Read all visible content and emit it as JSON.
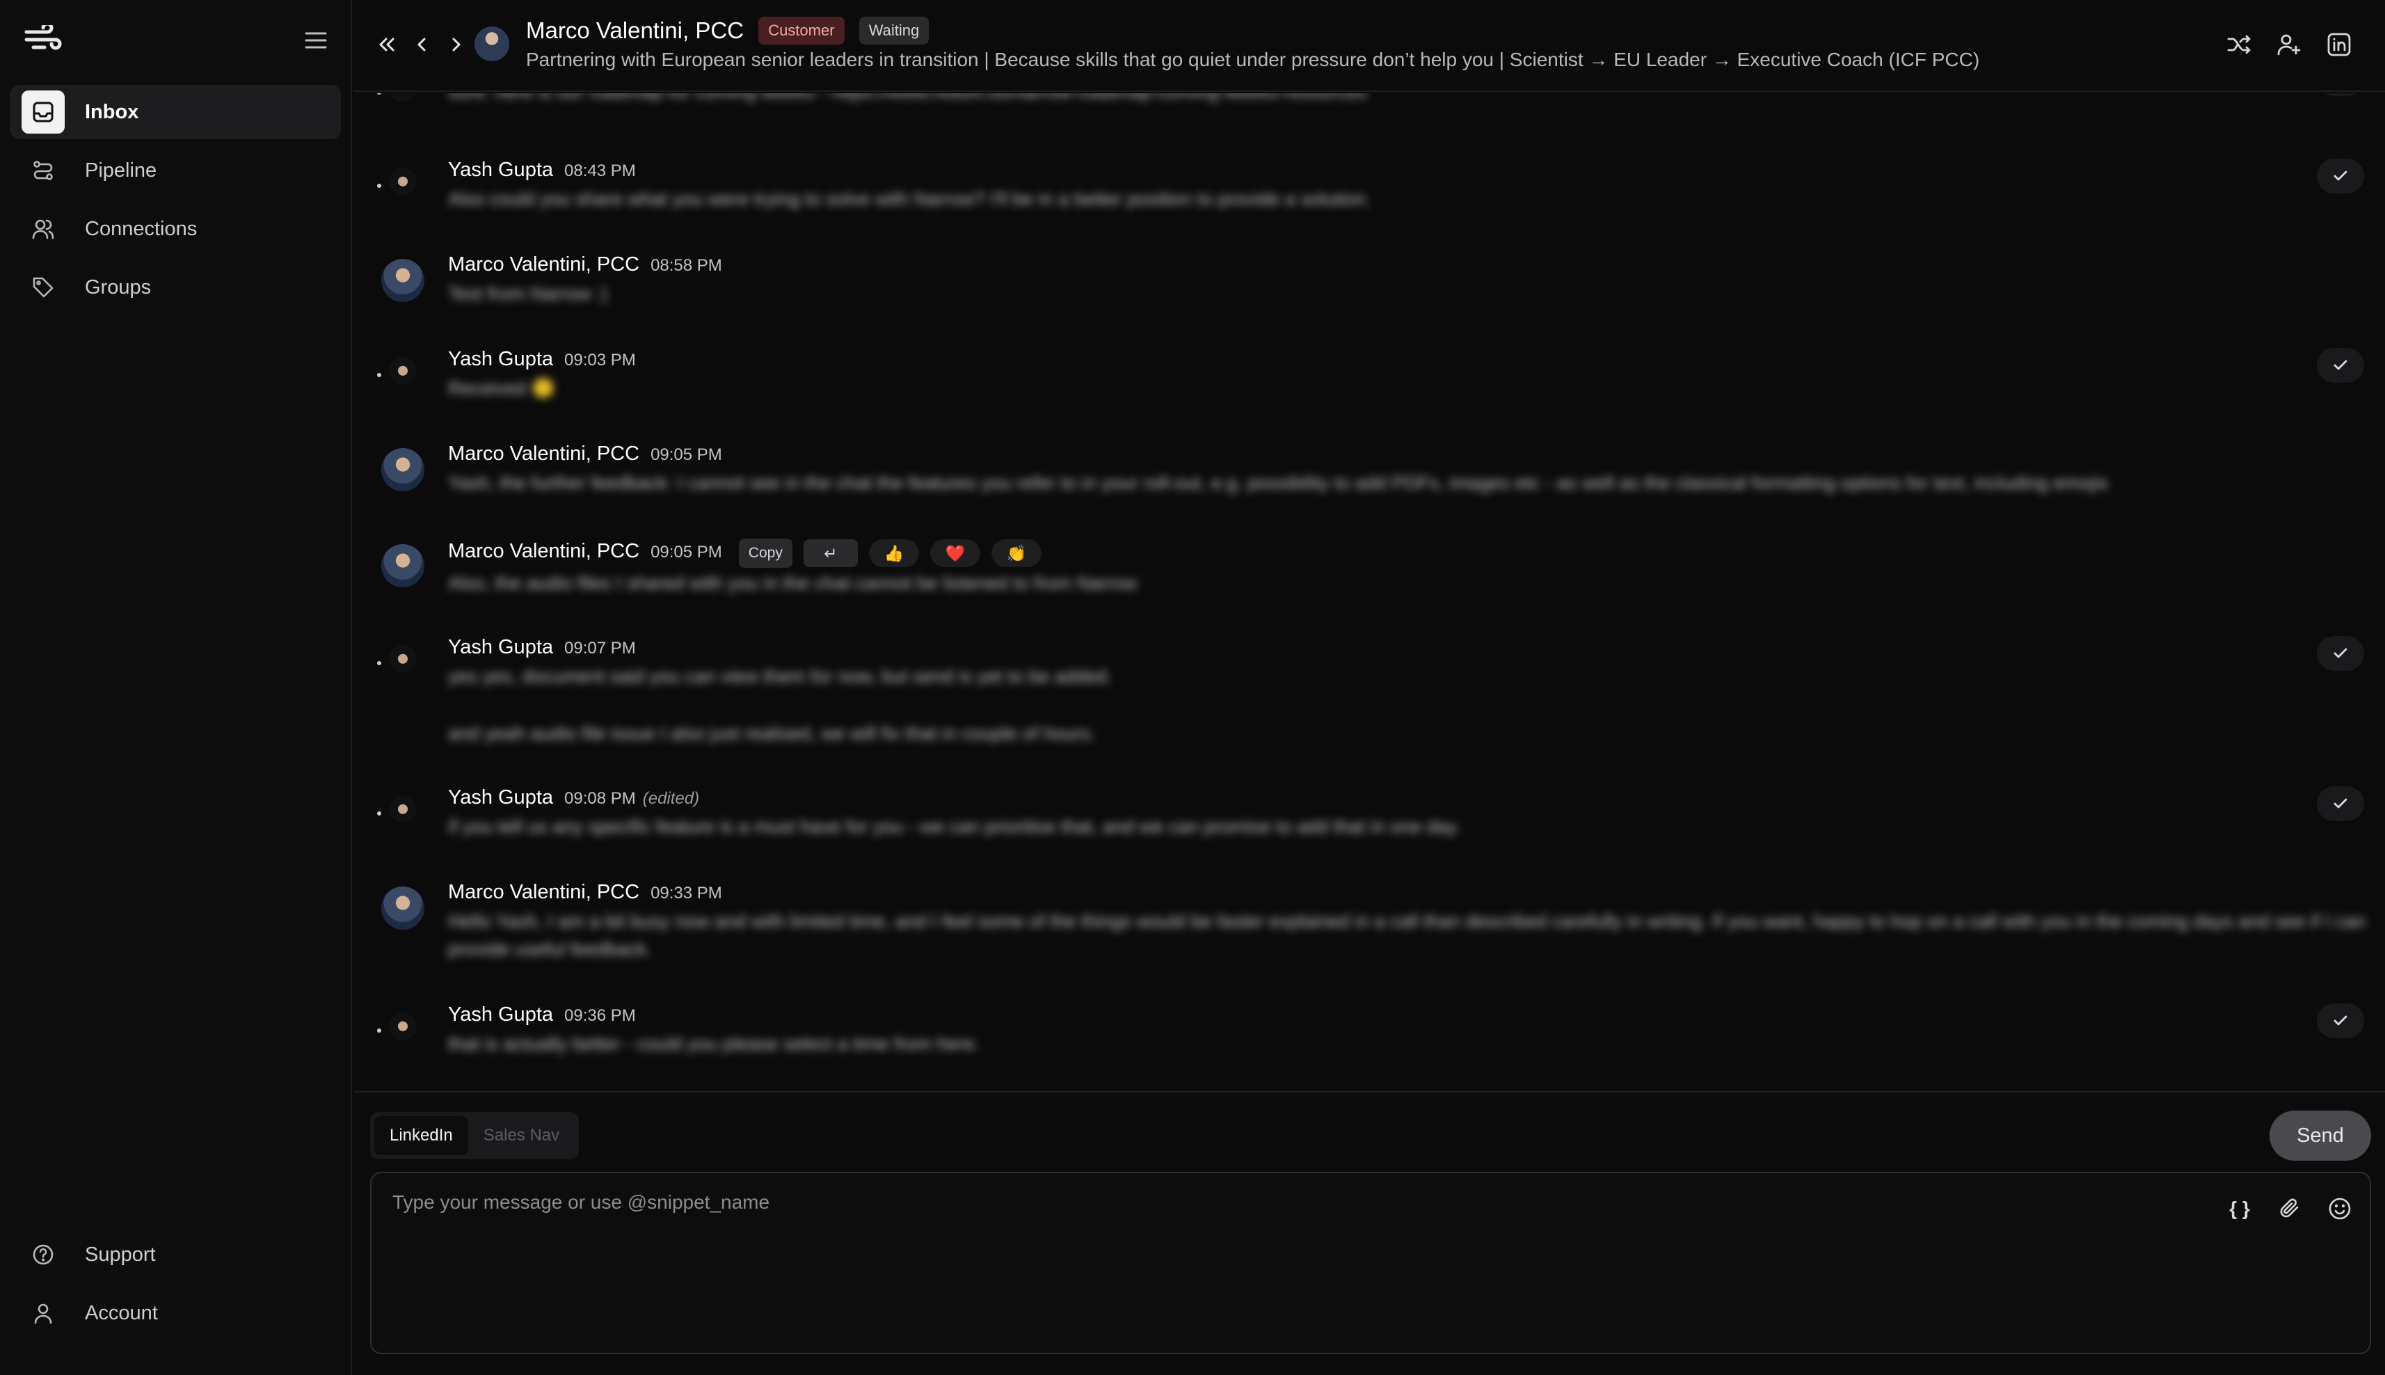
{
  "sidebar": {
    "items": [
      {
        "label": "Inbox",
        "icon": "inbox-icon"
      },
      {
        "label": "Pipeline",
        "icon": "pipeline-icon"
      },
      {
        "label": "Connections",
        "icon": "users-icon"
      },
      {
        "label": "Groups",
        "icon": "tag-icon"
      }
    ],
    "bottom": [
      {
        "label": "Support",
        "icon": "help-circle-icon"
      },
      {
        "label": "Account",
        "icon": "user-icon"
      }
    ]
  },
  "header": {
    "name": "Marco Valentini, PCC",
    "badges": {
      "customer": "Customer",
      "waiting": "Waiting"
    },
    "subtitle": "Partnering with European senior leaders in transition | Because skills that go quiet under pressure don’t help you | Scientist → EU Leader → Executive Coach (ICF PCC)"
  },
  "messages": [
    {
      "author": "Yash Gupta",
      "time": "08:43 PM",
      "body": "Also could you share what you were trying to solve with Narrow? I'll be in a better position to provide a solution."
    },
    {
      "author": "Marco Valentini, PCC",
      "time": "08:58 PM",
      "body": "Test from Narrow :)"
    },
    {
      "author": "Yash Gupta",
      "time": "09:03 PM",
      "body": "Received 🙂"
    },
    {
      "author": "Marco Valentini, PCC",
      "time": "09:05 PM",
      "body": "Yash, the further feedback: I cannot see in the chat the features you refer to in your roll-out, e.g. possibility to add PDFs, images etc - as well as the classical formatting options for text, including emojis"
    },
    {
      "author": "Marco Valentini, PCC",
      "time": "09:05 PM",
      "body": "Also, the audio files I shared with you in the chat cannot be listened to from Narrow"
    },
    {
      "author": "Yash Gupta",
      "time": "09:07 PM",
      "body": "yes yes, document said you can view them for now, but send is yet to be added.",
      "body2": "and yeah audio file issue I also just realised, we will fix that in couple of hours."
    },
    {
      "author": "Yash Gupta",
      "time": "09:08 PM",
      "edited": "(edited)",
      "body": "if you tell us any specific feature is a must have for you - we can prioritise that, and we can promise to add that in one day."
    },
    {
      "author": "Marco Valentini, PCC",
      "time": "09:33 PM",
      "body": "Hello Yash, I am a bit busy now and with limited time, and I feel some of the things would be faster explained in a call than described carefully in writing. If you want, happy to hop on a call with you in the coming days and see if I can provide useful feedback."
    },
    {
      "author": "Yash Gupta",
      "time": "09:36 PM",
      "body": "that is actually better - could you please select a time from here."
    }
  ],
  "top_partial_body": "sure. here is our roadmap for coming weeks - https://www.notion.so/narrow-roadmap-coming-weeks-resources",
  "hover_actions": {
    "copy": "Copy",
    "reply": "↵",
    "emojis": [
      "👍",
      "❤️",
      "👏"
    ]
  },
  "composer": {
    "tabs": [
      "LinkedIn",
      "Sales Nav"
    ],
    "send": "Send",
    "placeholder": "Type your message or use @snippet_name",
    "snippet_symbol": "{ }"
  }
}
